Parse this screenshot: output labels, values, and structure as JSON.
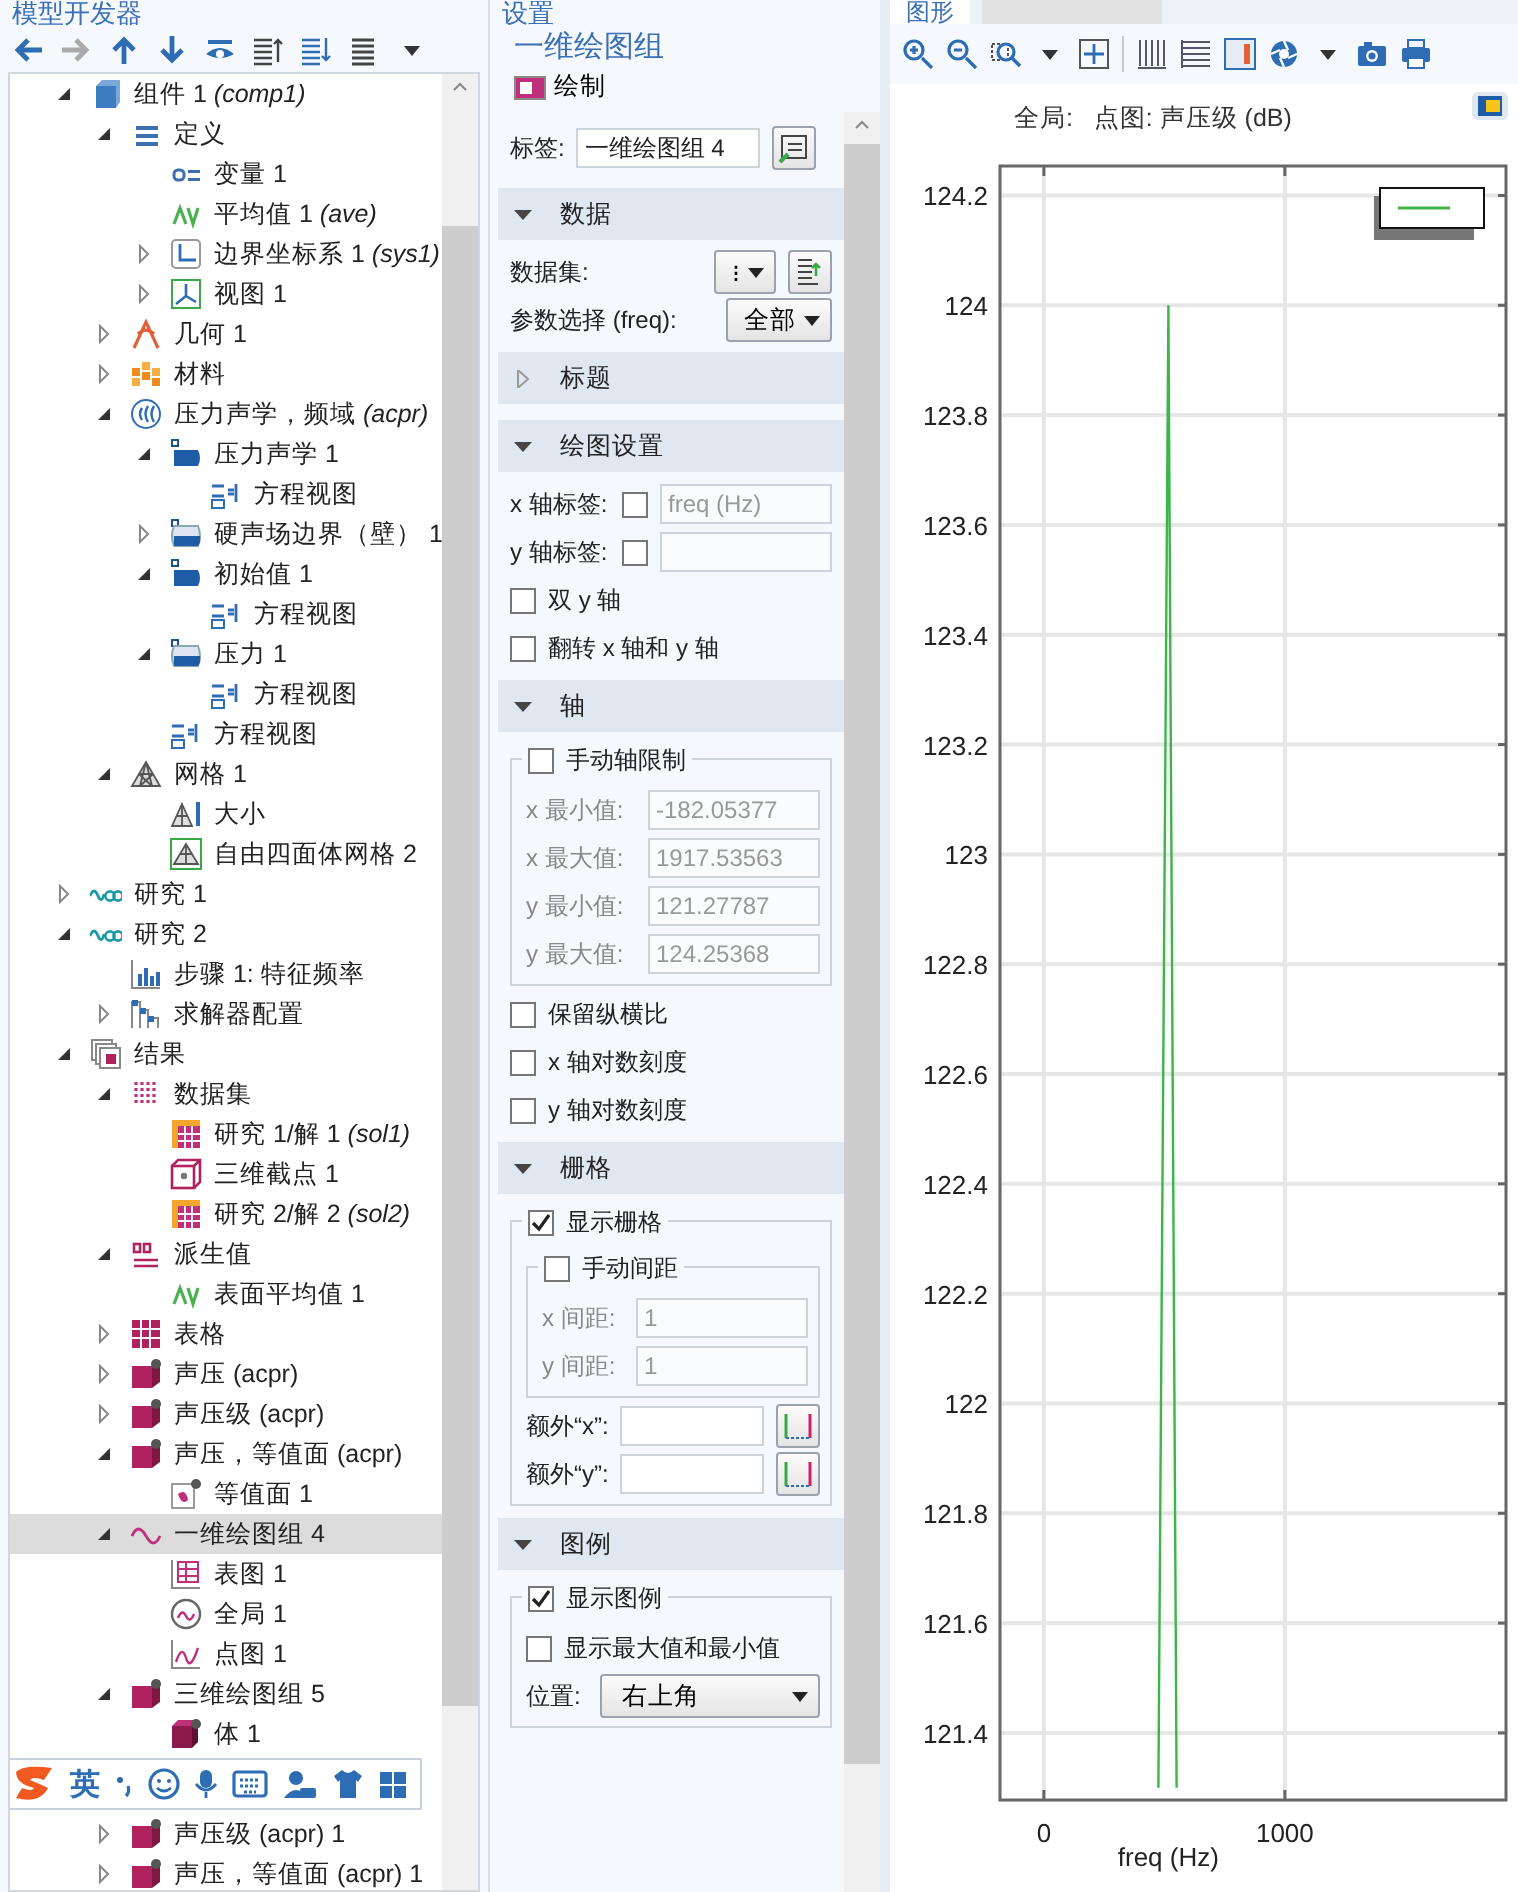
{
  "model_builder": {
    "title": "模型开发器",
    "tree": [
      {
        "label": "组件 1 *(comp1)*",
        "kind": "component",
        "expanded": true,
        "selected": false,
        "children": [
          {
            "label": "定义",
            "kind": "definitions",
            "expanded": true,
            "selected": false,
            "children": [
              {
                "label": "变量 1",
                "kind": "variable",
                "selected": false
              },
              {
                "label": "平均值 1 *(ave)*",
                "kind": "average",
                "selected": false
              },
              {
                "label": "边界坐标系 1 *(sys1)*",
                "kind": "coord",
                "expanded": false,
                "selected": false
              },
              {
                "label": "视图 1",
                "kind": "view",
                "expanded": false,
                "selected": false
              }
            ]
          },
          {
            "label": "几何 1",
            "kind": "geometry",
            "expanded": false,
            "selected": false
          },
          {
            "label": "材料",
            "kind": "materials",
            "expanded": false,
            "selected": false
          },
          {
            "label": "压力声学，频域 *(acpr)*",
            "kind": "physics",
            "expanded": true,
            "selected": false,
            "children": [
              {
                "label": "压力声学 1",
                "kind": "domain",
                "expanded": true,
                "selected": false,
                "children": [
                  {
                    "label": "方程视图",
                    "kind": "equation",
                    "selected": false
                  }
                ]
              },
              {
                "label": "硬声场边界（壁） 1",
                "kind": "boundary",
                "expanded": false,
                "selected": false
              },
              {
                "label": "初始值 1",
                "kind": "domain",
                "expanded": true,
                "selected": false,
                "children": [
                  {
                    "label": "方程视图",
                    "kind": "equation",
                    "selected": false
                  }
                ]
              },
              {
                "label": "压力 1",
                "kind": "boundary",
                "expanded": true,
                "selected": false,
                "children": [
                  {
                    "label": "方程视图",
                    "kind": "equation",
                    "selected": false
                  }
                ]
              },
              {
                "label": "方程视图",
                "kind": "equation",
                "selected": false
              }
            ]
          },
          {
            "label": "网格 1",
            "kind": "mesh",
            "expanded": true,
            "selected": false,
            "children": [
              {
                "label": "大小",
                "kind": "size",
                "selected": false
              },
              {
                "label": "自由四面体网格 2",
                "kind": "freetet",
                "selected": false
              }
            ]
          }
        ]
      },
      {
        "label": "研究 1",
        "kind": "study",
        "expanded": false,
        "selected": false
      },
      {
        "label": "研究 2",
        "kind": "study",
        "expanded": true,
        "selected": false,
        "children": [
          {
            "label": "步骤 1: 特征频率",
            "kind": "step",
            "selected": false
          },
          {
            "label": "求解器配置",
            "kind": "solver",
            "expanded": false,
            "selected": false
          }
        ]
      },
      {
        "label": "结果",
        "kind": "results",
        "expanded": true,
        "selected": false,
        "children": [
          {
            "label": "数据集",
            "kind": "datasets",
            "expanded": true,
            "selected": false,
            "children": [
              {
                "label": "研究 1/解 1 *(sol1)*",
                "kind": "solution",
                "selected": false
              },
              {
                "label": "三维截点 1",
                "kind": "cutpoint",
                "selected": false
              },
              {
                "label": "研究 2/解 2 *(sol2)*",
                "kind": "solution",
                "selected": false
              }
            ]
          },
          {
            "label": "派生值",
            "kind": "derived",
            "expanded": true,
            "selected": false,
            "children": [
              {
                "label": "表面平均值 1",
                "kind": "average",
                "selected": false
              }
            ]
          },
          {
            "label": "表格",
            "kind": "table",
            "expanded": false,
            "selected": false
          },
          {
            "label": "声压 (acpr)",
            "kind": "plot3d",
            "expanded": false,
            "selected": false
          },
          {
            "label": "声压级 (acpr)",
            "kind": "plot3d",
            "expanded": false,
            "selected": false
          },
          {
            "label": "声压，等值面 (acpr)",
            "kind": "plot3d",
            "expanded": true,
            "selected": false,
            "children": [
              {
                "label": "等值面 1",
                "kind": "isosurface",
                "selected": false
              }
            ]
          },
          {
            "label": "一维绘图组 4",
            "kind": "plot1d",
            "expanded": true,
            "selected": true,
            "children": [
              {
                "label": "表图 1",
                "kind": "tableplot",
                "selected": false
              },
              {
                "label": "全局 1",
                "kind": "global",
                "selected": false
              },
              {
                "label": "点图 1",
                "kind": "pointgraph",
                "selected": false
              }
            ]
          },
          {
            "label": "三维绘图组 5",
            "kind": "plot3d",
            "expanded": true,
            "selected": false,
            "children": [
              {
                "label": "体 1",
                "kind": "volume",
                "selected": false
              }
            ]
          }
        ]
      }
    ],
    "tree_after_overlay": [
      {
        "label": "声压级 (acpr) 1",
        "kind": "plot3d",
        "expanded": false,
        "selected": false
      },
      {
        "label": "声压，等值面 (acpr) 1",
        "kind": "plot3d",
        "expanded": false,
        "selected": false
      }
    ]
  },
  "ime_toolbar": {
    "mode": "英"
  },
  "settings": {
    "title": "设置",
    "node_title": "一维绘图组",
    "plot_button": "绘制",
    "label_field": {
      "label": "标签:",
      "value": "一维绘图组 4"
    },
    "sections": [
      {
        "title": "数据",
        "expanded": true,
        "rows": [
          {
            "kind": "dropdown",
            "label": "数据集:",
            "value": "⁝",
            "button": true
          },
          {
            "kind": "dropdown",
            "label": "参数选择 (freq):",
            "value": "全部"
          }
        ]
      },
      {
        "title": "标题",
        "expanded": false
      },
      {
        "title": "绘图设置",
        "expanded": true,
        "rows": [
          {
            "kind": "field",
            "label": "x 轴标签:",
            "checked": false,
            "value": "freq (Hz)",
            "disabled": true
          },
          {
            "kind": "field",
            "label": "y 轴标签:",
            "checked": false,
            "disabled": true
          },
          {
            "kind": "checkbox",
            "label": "双 y 轴",
            "checked": false
          },
          {
            "kind": "checkbox",
            "label": "翻转 x 轴和 y 轴",
            "checked": false
          }
        ]
      },
      {
        "title": "轴",
        "expanded": true,
        "rows": [
          {
            "kind": "group",
            "label": "手动轴限制",
            "checked": false,
            "rows": [
              {
                "kind": "field",
                "label": "x 最小值:",
                "value": "-182.05377",
                "disabled": true
              },
              {
                "kind": "field",
                "label": "x 最大值:",
                "value": "1917.53563",
                "disabled": true
              },
              {
                "kind": "field",
                "label": "y 最小值:",
                "value": "121.27787",
                "disabled": true
              },
              {
                "kind": "field",
                "label": "y 最大值:",
                "value": "124.25368",
                "disabled": true
              }
            ]
          },
          {
            "kind": "checkbox",
            "label": "保留纵横比",
            "checked": false
          },
          {
            "kind": "checkbox",
            "label": "x 轴对数刻度",
            "checked": false
          },
          {
            "kind": "checkbox",
            "label": "y 轴对数刻度",
            "checked": false
          }
        ]
      },
      {
        "title": "栅格",
        "expanded": true,
        "rows": [
          {
            "kind": "group",
            "label": "显示栅格",
            "checked": true,
            "rows": [
              {
                "kind": "group",
                "label": "手动间距",
                "checked": false,
                "rows": [
                  {
                    "kind": "field",
                    "label": "x 间距:",
                    "value": "1",
                    "disabled": true
                  },
                  {
                    "kind": "field",
                    "label": "y 间距:",
                    "value": "1",
                    "disabled": true
                  }
                ]
              },
              {
                "kind": "field",
                "label": "额外“x”:",
                "disabled": false,
                "button": true
              },
              {
                "kind": "field",
                "label": "额外“y”:",
                "disabled": false,
                "button": true
              }
            ]
          }
        ]
      },
      {
        "title": "图例",
        "expanded": true,
        "rows": [
          {
            "kind": "group",
            "label": "显示图例",
            "checked": true,
            "rows": [
              {
                "kind": "checkbox",
                "label": "显示最大值和最小值",
                "checked": false
              },
              {
                "kind": "dropdown",
                "label": "位置:",
                "value": "右上角"
              }
            ]
          }
        ]
      }
    ]
  },
  "graphics": {
    "tab": "图形",
    "chart_data": {
      "type": "line",
      "title": "全局:   点图: 声压级 (dB)",
      "xlabel": "freq (Hz)",
      "grid": true,
      "x": [
        475,
        517,
        551
      ],
      "series": [
        {
          "color": "#3cb54a",
          "values": [
            121.3,
            124,
            121.3
          ]
        }
      ],
      "xlim": [
        -182.05377,
        1917.53563
      ],
      "ylim": [
        121.27787,
        124.25368
      ],
      "xticks": [
        0,
        1000
      ],
      "yticks": [
        121.4,
        121.6,
        121.8,
        122,
        122.2,
        122.4,
        122.6,
        122.8,
        123,
        123.2,
        123.4,
        123.6,
        123.8,
        124,
        124.2
      ]
    }
  }
}
